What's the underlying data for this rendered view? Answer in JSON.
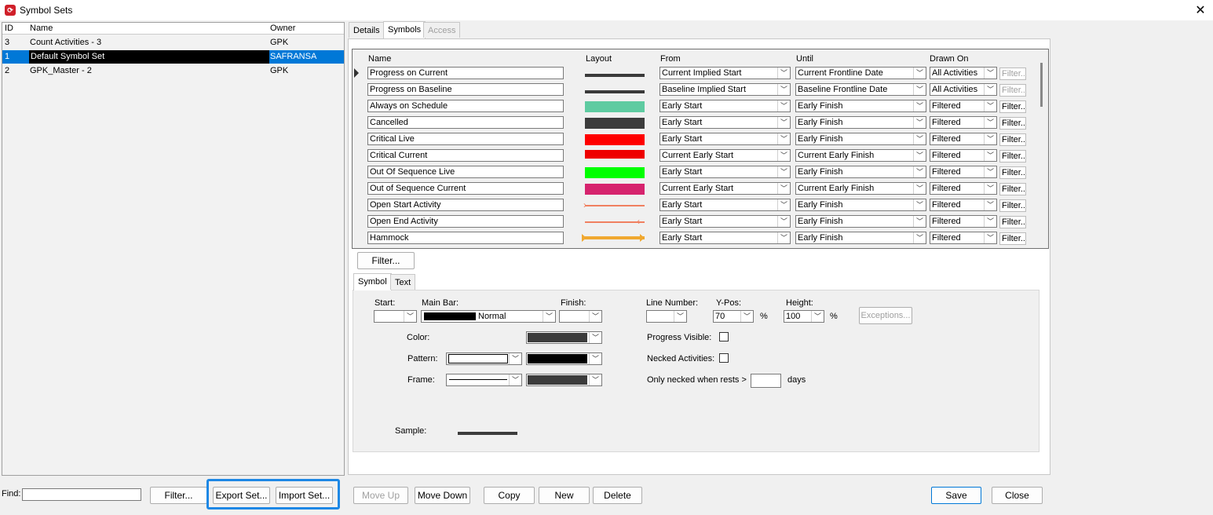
{
  "window": {
    "title": "Symbol Sets",
    "app_icon": "app-logo-icon",
    "close_icon": "close-icon"
  },
  "set_list": {
    "columns": [
      "ID",
      "Name",
      "Owner"
    ],
    "rows": [
      {
        "id": "3",
        "name": "Count Activities - 3",
        "owner": "GPK",
        "selected": false
      },
      {
        "id": "1",
        "name": "Default Symbol Set",
        "owner": "SAFRANSA",
        "selected": true
      },
      {
        "id": "2",
        "name": "GPK_Master - 2",
        "owner": "GPK",
        "selected": false
      }
    ]
  },
  "tabs": [
    {
      "label": "Details",
      "active": false,
      "disabled": false
    },
    {
      "label": "Symbols",
      "active": true,
      "disabled": false
    },
    {
      "label": "Access",
      "active": false,
      "disabled": true
    }
  ],
  "symbols_grid": {
    "columns": [
      "Name",
      "Layout",
      "From",
      "Until",
      "Drawn On"
    ],
    "rows": [
      {
        "name": "Progress on Current",
        "layout": "dark-line",
        "color": "#3a3a3a",
        "from": "Current Implied Start",
        "until": "Current Frontline Date",
        "drawn_on": "All Activities",
        "filter": "Filter...",
        "filter_enabled": false,
        "current": true
      },
      {
        "name": "Progress on Baseline",
        "layout": "dark-line",
        "color": "#3a3a3a",
        "from": "Baseline Implied Start",
        "until": "Baseline Frontline Date",
        "drawn_on": "All Activities",
        "filter": "Filter...",
        "filter_enabled": false
      },
      {
        "name": "Always on Schedule",
        "layout": "bar",
        "color": "#5ecba1",
        "from": "Early Start",
        "until": "Early Finish",
        "drawn_on": "Filtered",
        "filter": "Filter...",
        "filter_enabled": true
      },
      {
        "name": "Cancelled",
        "layout": "bar",
        "color": "#3c3c3c",
        "from": "Early Start",
        "until": "Early Finish",
        "drawn_on": "Filtered",
        "filter": "Filter...",
        "filter_enabled": true
      },
      {
        "name": "Critical Live",
        "layout": "bar",
        "color": "#ff0000",
        "from": "Early Start",
        "until": "Early Finish",
        "drawn_on": "Filtered",
        "filter": "Filter...",
        "filter_enabled": true
      },
      {
        "name": "Critical Current",
        "layout": "bar-thin",
        "color": "#ee0000",
        "from": "Current Early Start",
        "until": "Current Early Finish",
        "drawn_on": "Filtered",
        "filter": "Filter...",
        "filter_enabled": true
      },
      {
        "name": "Out Of Sequence Live",
        "layout": "bar",
        "color": "#00ff00",
        "from": "Early Start",
        "until": "Early Finish",
        "drawn_on": "Filtered",
        "filter": "Filter...",
        "filter_enabled": true
      },
      {
        "name": "Out of Sequence Current",
        "layout": "bar",
        "color": "#d6246e",
        "from": "Current Early Start",
        "until": "Current Early Finish",
        "drawn_on": "Filtered",
        "filter": "Filter...",
        "filter_enabled": true
      },
      {
        "name": "Open Start Activity",
        "layout": "open-start",
        "color": "#f08060",
        "from": "Early Start",
        "until": "Early Finish",
        "drawn_on": "Filtered",
        "filter": "Filter...",
        "filter_enabled": true
      },
      {
        "name": "Open End Activity",
        "layout": "open-end",
        "color": "#f08060",
        "from": "Early Start",
        "until": "Early Finish",
        "drawn_on": "Filtered",
        "filter": "Filter...",
        "filter_enabled": true
      },
      {
        "name": "Hammock",
        "layout": "hammock",
        "color": "#f0a830",
        "from": "Early Start",
        "until": "Early Finish",
        "drawn_on": "Filtered",
        "filter": "Filter...",
        "filter_enabled": true
      }
    ]
  },
  "grid_filter_button": "Filter...",
  "symbol_tabs": [
    {
      "label": "Symbol",
      "active": true
    },
    {
      "label": "Text",
      "active": false
    }
  ],
  "symbol_panel": {
    "start_label": "Start:",
    "main_bar_label": "Main Bar:",
    "main_bar_value": "Normal",
    "finish_label": "Finish:",
    "line_number_label": "Line Number:",
    "ypos_label": "Y-Pos:",
    "ypos_value": "70",
    "height_label": "Height:",
    "height_value": "100",
    "percent": "%",
    "exceptions_button": "Exceptions...",
    "color_label": "Color:",
    "pattern_label": "Pattern:",
    "frame_label": "Frame:",
    "progress_visible_label": "Progress Visible:",
    "necked_label": "Necked Activities:",
    "necked_rest_label": "Only necked when rests >",
    "days_label": "days",
    "sample_label": "Sample:",
    "color_value": "#3c3c3c"
  },
  "bottom": {
    "find_label": "Find:",
    "find_value": "",
    "filter_button": "Filter...",
    "export_button": "Export Set...",
    "import_button": "Import Set...",
    "move_up": "Move Up",
    "move_down": "Move Down",
    "copy": "Copy",
    "new": "New",
    "delete": "Delete",
    "save": "Save",
    "close": "Close"
  }
}
